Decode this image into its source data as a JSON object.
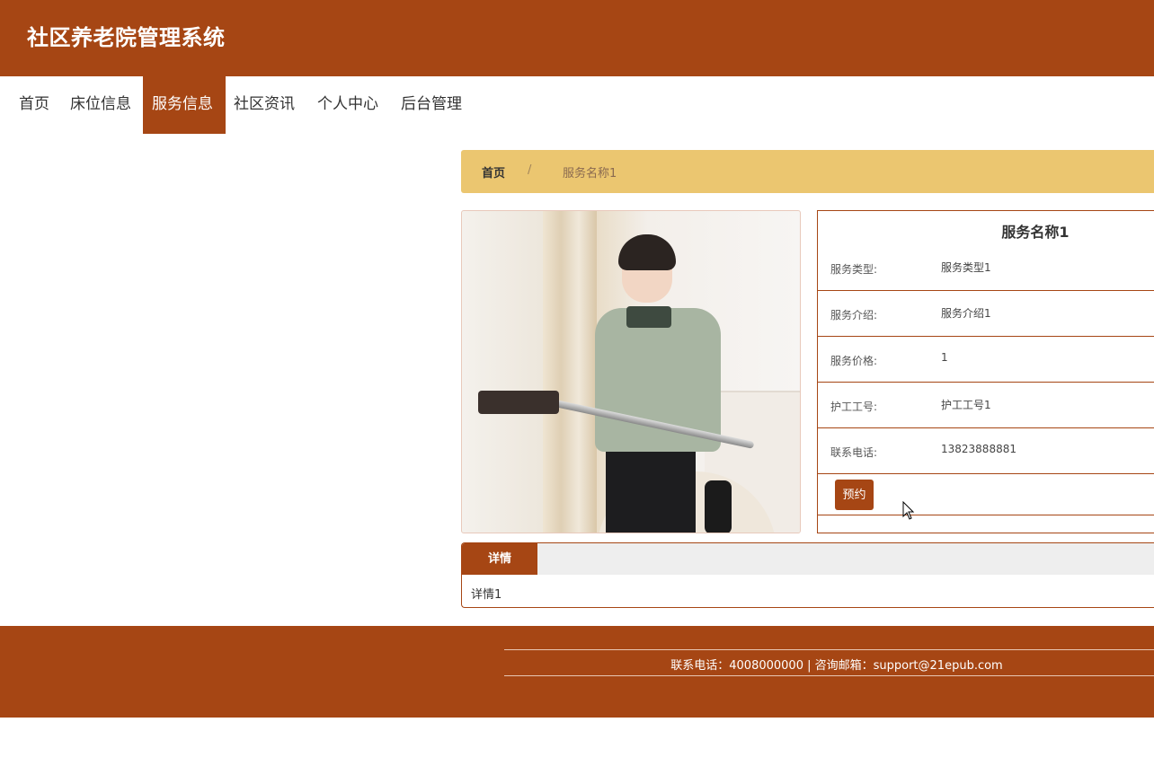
{
  "header": {
    "title": "社区养老院管理系统"
  },
  "nav": {
    "items": [
      {
        "label": "首页"
      },
      {
        "label": "床位信息"
      },
      {
        "label": "服务信息"
      },
      {
        "label": "社区资讯"
      },
      {
        "label": "个人中心"
      },
      {
        "label": "后台管理"
      }
    ],
    "active": "服务信息"
  },
  "breadcrumb": {
    "home": "首页",
    "separator": "/",
    "current": "服务名称1"
  },
  "service": {
    "title": "服务名称1",
    "rows": [
      {
        "label": "服务类型:",
        "value": "服务类型1"
      },
      {
        "label": "服务介绍:",
        "value": "服务介绍1"
      },
      {
        "label": "服务价格:",
        "value": "1"
      },
      {
        "label": "护工工号:",
        "value": "护工工号1"
      },
      {
        "label": "联系电话:",
        "value": "13823888881"
      }
    ],
    "book_label": "预约"
  },
  "detail": {
    "tab_label": "详情",
    "content": "详情1"
  },
  "footer": {
    "text": "联系电话：4008000000 | 咨询邮箱：support@21epub.com"
  },
  "colors": {
    "brand": "#a64614",
    "breadcrumb_bg": "#ebc670"
  }
}
